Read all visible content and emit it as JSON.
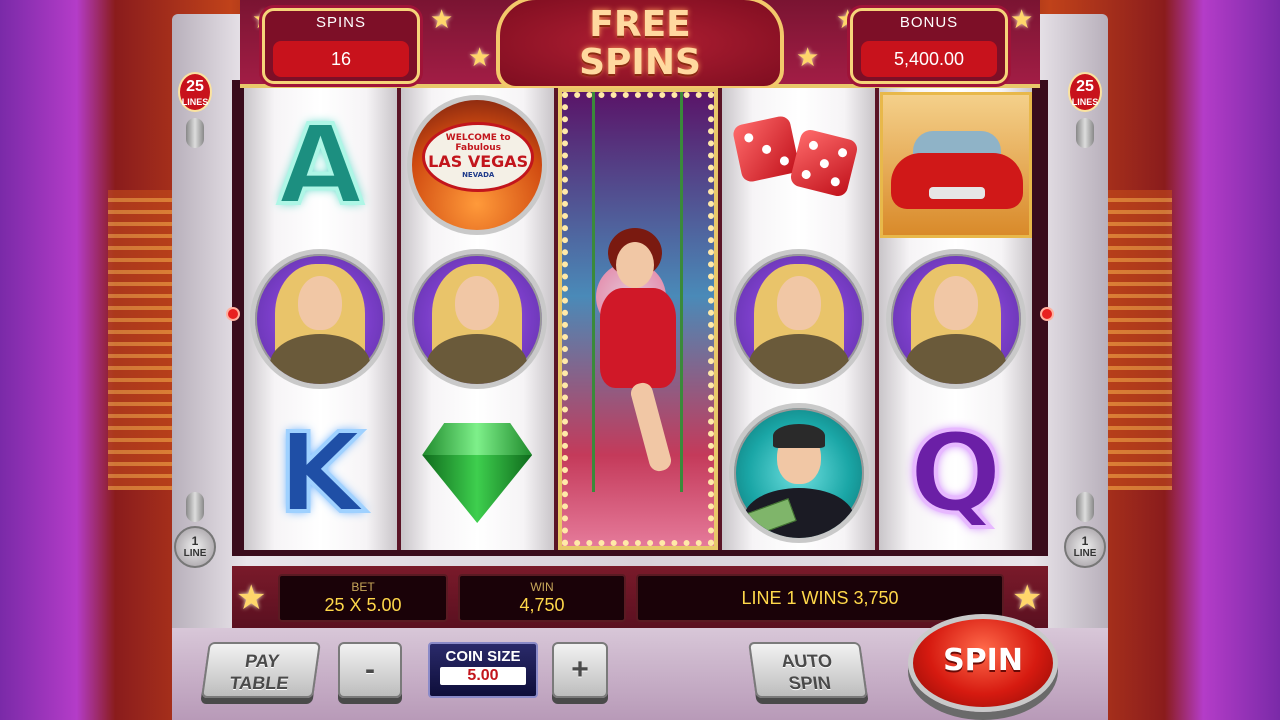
{
  "header": {
    "spins_label": "SPINS",
    "spins_value": "16",
    "free_spins_title": "FREE\nSPINS",
    "bonus_label": "BONUS",
    "bonus_value": "5,400.00"
  },
  "lines_indicator": {
    "left_top_number": "25",
    "left_top_text": "LINES",
    "right_top_number": "25",
    "right_top_text": "LINES",
    "left_bottom_number": "1",
    "left_bottom_text": "LINE",
    "right_bottom_number": "1",
    "right_bottom_text": "LINE"
  },
  "reels": [
    [
      "A",
      "lady",
      "K"
    ],
    [
      "las-vegas",
      "lady",
      "emerald"
    ],
    [
      "showgirl-full"
    ],
    [
      "dice",
      "lady",
      "man-with-money"
    ],
    [
      "red-car",
      "lady",
      "Q"
    ]
  ],
  "vegas_sign": {
    "welcome": "WELCOME to Fabulous",
    "las_vegas": "LAS VEGAS",
    "nevada": "NEVADA"
  },
  "info_bar": {
    "bet_label": "BET",
    "bet_value": "25 X 5.00",
    "win_label": "WIN",
    "win_value": "4,750",
    "message": "LINE 1 WINS 3,750"
  },
  "controls": {
    "paytable_label_line1": "PAY",
    "paytable_label_line2": "TABLE",
    "minus_label": "-",
    "coin_size_label": "COIN SIZE",
    "coin_size_value": "5.00",
    "plus_label": "+",
    "autospin_label_line1": "AUTO",
    "autospin_label_line2": "SPIN",
    "spin_label": "SPIN"
  },
  "colors": {
    "accent_gold": "#f6d47a",
    "value_yellow": "#ffd84a",
    "spin_red": "#d61a10"
  }
}
